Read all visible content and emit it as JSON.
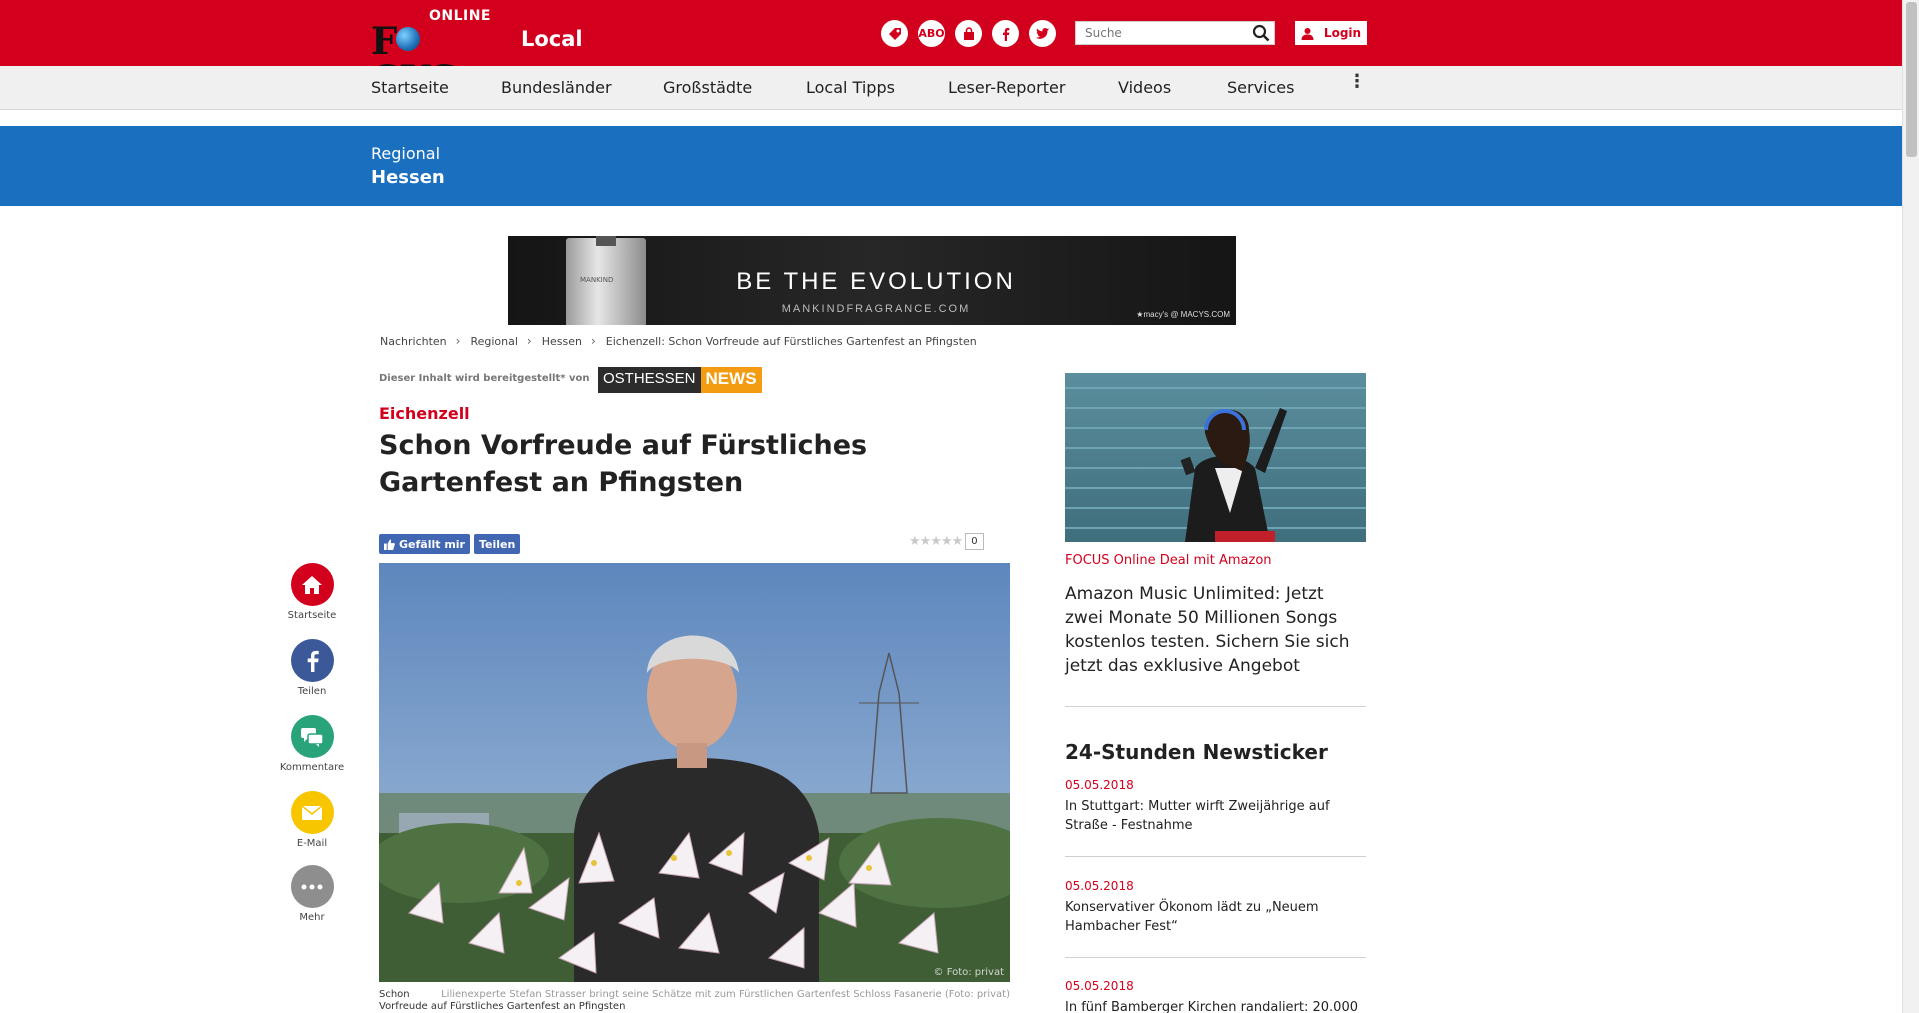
{
  "header": {
    "logo_online": "ONLINE",
    "logo_focus_pre": "F",
    "logo_focus_post": "CUS",
    "section": "Local",
    "abo_label": "ABO",
    "search_placeholder": "Suche",
    "login_label": "Login"
  },
  "nav": {
    "items": [
      "Startseite",
      "Bundesländer",
      "Großstädte",
      "Local Tipps",
      "Leser-Reporter",
      "Videos",
      "Services"
    ]
  },
  "band": {
    "region": "Regional",
    "state": "Hessen"
  },
  "ad": {
    "headline": "BE THE EVOLUTION",
    "url": "MANKINDFRAGRANCE.COM",
    "brand": "★macy's  @ MACYS.COM",
    "bottle_label": "MANKIND"
  },
  "breadcrumb": [
    "Nachrichten",
    "Regional",
    "Hessen",
    "Eichenzell: Schon Vorfreude auf Fürstliches Gartenfest an Pfingsten"
  ],
  "article": {
    "provided_by": "Dieser Inhalt wird bereitgestellt* von",
    "partner_a": "OSTHESSEN",
    "partner_b": "NEWS",
    "kicker": "Eichenzell",
    "headline": "Schon Vorfreude auf Fürstliches Gartenfest an Pfingsten",
    "like_label": "Gefällt mir",
    "share_label": "Teilen",
    "rating_count": "0",
    "photo_credit": "© Foto: privat",
    "caption_left": "Schon",
    "caption_right": "Lilienexperte Stefan Strasser bringt seine Schätze mit zum Fürstlichen Gartenfest Schloss Fasanerie (Foto: privat)",
    "caption_cont": "Vorfreude auf Fürstliches Gartenfest an Pfingsten"
  },
  "share_bar": {
    "home": "Startseite",
    "facebook": "Teilen",
    "comments": "Kommentare",
    "email": "E-Mail",
    "more": "Mehr"
  },
  "sidebar": {
    "deal_link": "FOCUS Online Deal mit Amazon",
    "deal_text": "Amazon Music Unlimited: Jetzt zwei Monate 50 Millionen Songs kostenlos testen. Sichern Sie sich jetzt das exklusive Angebot",
    "ticker_title": "24-Stunden Newsticker",
    "ticker": [
      {
        "date": "05.05.2018",
        "text": "In Stuttgart: Mutter wirft Zweijährige auf Straße - Festnahme"
      },
      {
        "date": "05.05.2018",
        "text": "Konservativer Ökonom lädt zu „Neuem Hambacher Fest“"
      },
      {
        "date": "05.05.2018",
        "text": "In fünf Bamberger Kirchen randaliert: 20.000"
      }
    ]
  },
  "colors": {
    "brand_red": "#d3001d",
    "band_blue": "#1a6fbf",
    "facebook_blue": "#4267b2"
  }
}
